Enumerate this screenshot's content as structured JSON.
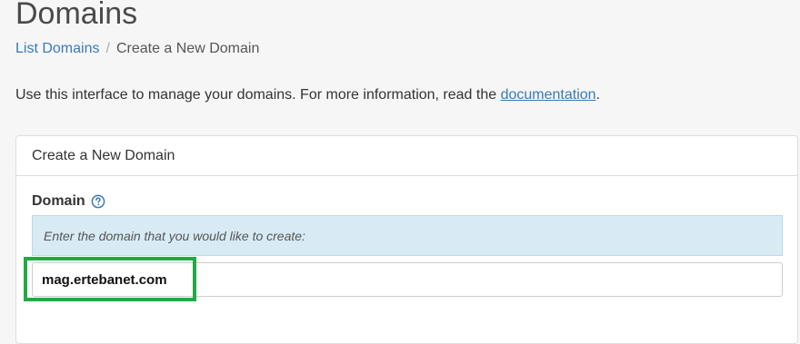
{
  "page": {
    "title": "Domains"
  },
  "breadcrumb": {
    "link_label": "List Domains",
    "separator": "/",
    "current": "Create a New Domain"
  },
  "intro": {
    "text": "Use this interface to manage your domains. For more information, read the ",
    "link_label": "documentation",
    "suffix": "."
  },
  "panel": {
    "heading": "Create a New Domain",
    "field_label": "Domain",
    "help_icon": "question-circle-icon",
    "help_text": "Enter the domain that you would like to create:",
    "input_value": "mag.ertebanet.com"
  },
  "colors": {
    "link": "#3a7ab8",
    "help_background": "#d8ebf5",
    "highlight": "#22aa44"
  }
}
